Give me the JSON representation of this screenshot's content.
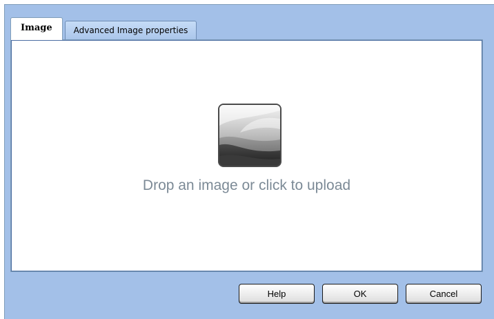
{
  "tabs": [
    {
      "label": "Image",
      "active": true
    },
    {
      "label": "Advanced Image properties",
      "active": false
    }
  ],
  "dropzone": {
    "icon": "image-placeholder-icon",
    "text": "Drop an image or click to upload"
  },
  "buttons": {
    "help_label": "Help",
    "ok_label": "OK",
    "cancel_label": "Cancel"
  },
  "colors": {
    "dialog_background": "#a3c0e8",
    "panel_background": "#ffffff",
    "drop_text": "#7c8a96"
  }
}
